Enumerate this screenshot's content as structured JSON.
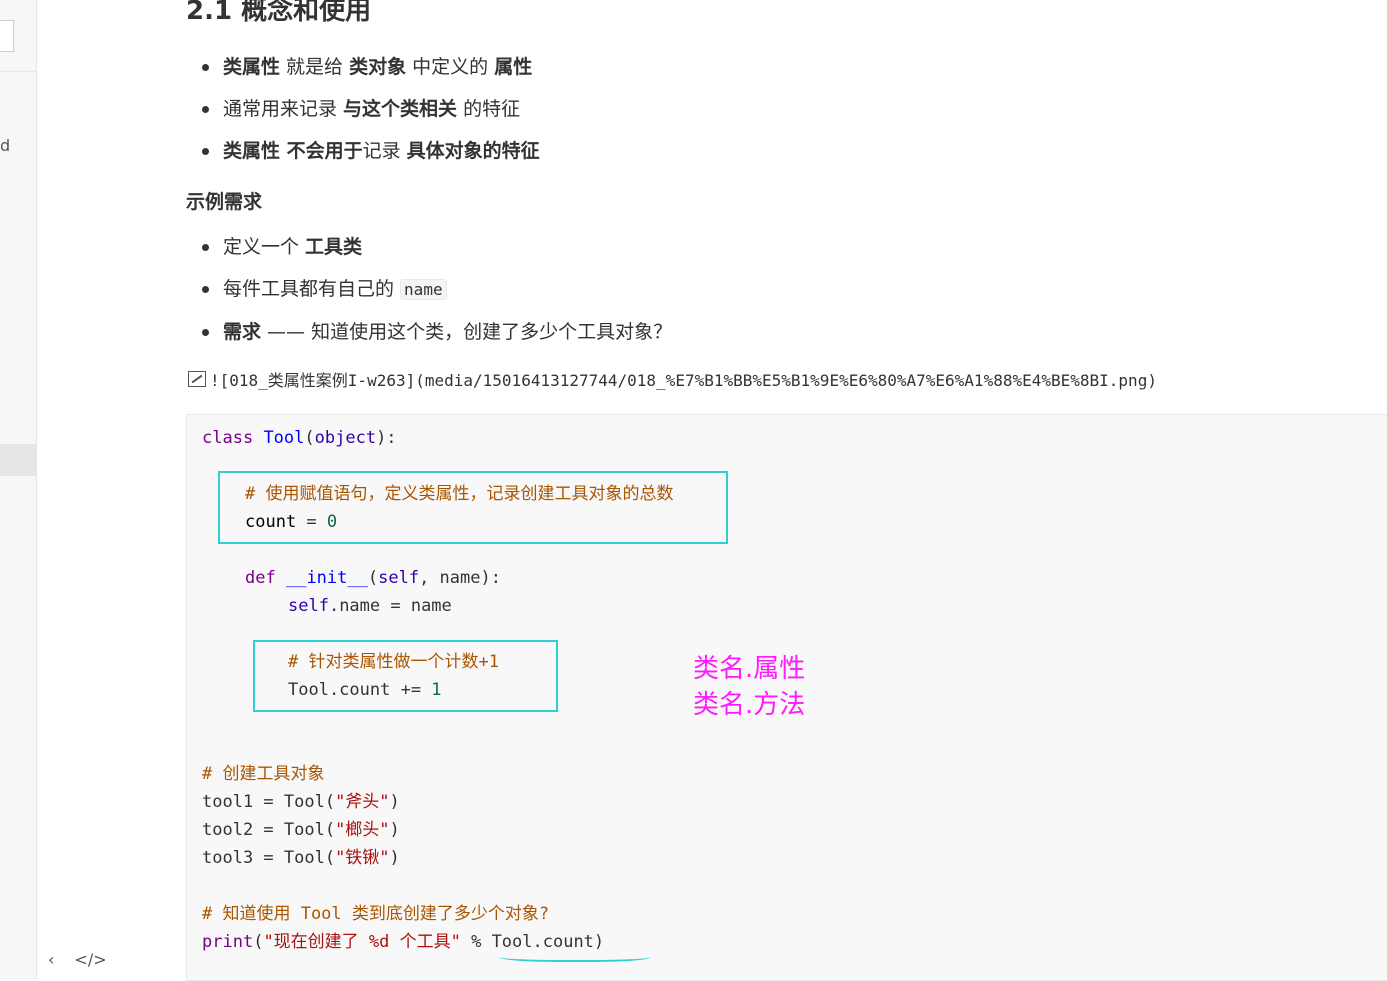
{
  "sidebar": {
    "partial_letter": "d"
  },
  "bottom_tools": {
    "collapse_icon": "‹",
    "source_icon": "</>"
  },
  "heading": "2.1 概念和使用",
  "list1": [
    {
      "b1": "类属性",
      "t1": " 就是给 ",
      "b2": "类对象",
      "t2": " 中定义的 ",
      "b3": "属性"
    },
    {
      "t1": "通常用来记录 ",
      "b1": "与这个类相关",
      "t2": " 的特征"
    },
    {
      "b1": "类属性 不会用于",
      "t1": "记录 ",
      "b2": "具体对象的特征"
    }
  ],
  "subhead": "示例需求",
  "list2": [
    {
      "t1": "定义一个 ",
      "b1": "工具类"
    },
    {
      "t1": "每件工具都有自己的 ",
      "code": "name"
    },
    {
      "b1": "需求",
      "t1": " —— 知道使用这个类，创建了多少个工具对象？"
    }
  ],
  "image_ref": "![018_类属性案例I-w263](media/15016413127744/018_%E7%B1%BB%E5%B1%9E%E6%80%A7%E6%A1%88%E4%BE%8BI.png)",
  "code": {
    "l1": [
      "class",
      " ",
      "Tool",
      "(",
      "object",
      "):"
    ],
    "comment1": "# 使用赋值语句，定义类属性，记录创建工具对象的总数",
    "count_line": [
      "count",
      " = ",
      "0"
    ],
    "def_line": [
      "def",
      " ",
      "__init__",
      "(",
      "self",
      ", name):"
    ],
    "self_line": [
      "self",
      ".name = name"
    ],
    "comment2": "# 针对类属性做一个计数+1",
    "inc_line": [
      "Tool.count += ",
      "1"
    ],
    "comment3": "# 创建工具对象",
    "tool1": [
      "tool1 = Tool(",
      "\"斧头\"",
      ")"
    ],
    "tool2": [
      "tool2 = Tool(",
      "\"榔头\"",
      ")"
    ],
    "tool3": [
      "tool3 = Tool(",
      "\"铁锹\"",
      ")"
    ],
    "comment4": "# 知道使用 Tool 类到底创建了多少个对象?",
    "print_line": [
      "print",
      "(",
      "\"现在创建了 %d 个工具\"",
      " % Tool.count)"
    ]
  },
  "annotation": {
    "line1": "类名.属性",
    "line2": "类名.方法"
  },
  "colors": {
    "highlight_box": "#2fcfd4",
    "annotation": "#ff1aff"
  }
}
